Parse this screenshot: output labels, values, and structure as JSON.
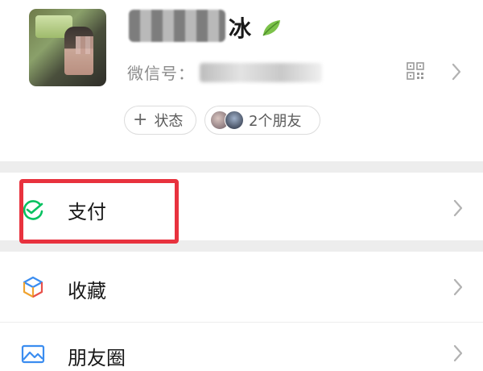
{
  "profile": {
    "name_visible": "冰",
    "wechat_id_label": "微信号：",
    "status_button": {
      "icon": "plus-icon",
      "label": "状态"
    },
    "friends_button": {
      "label": "2个朋友"
    }
  },
  "menu": {
    "items": [
      {
        "label": "支付",
        "icon": "wechat-pay-icon",
        "highlighted": true
      },
      {
        "label": "收藏",
        "icon": "cube-icon"
      },
      {
        "label": "朋友圈",
        "icon": "picture-icon"
      }
    ]
  },
  "colors": {
    "highlight_border": "#e8323e",
    "pay_green": "#07c160",
    "separator": "#ededed"
  }
}
